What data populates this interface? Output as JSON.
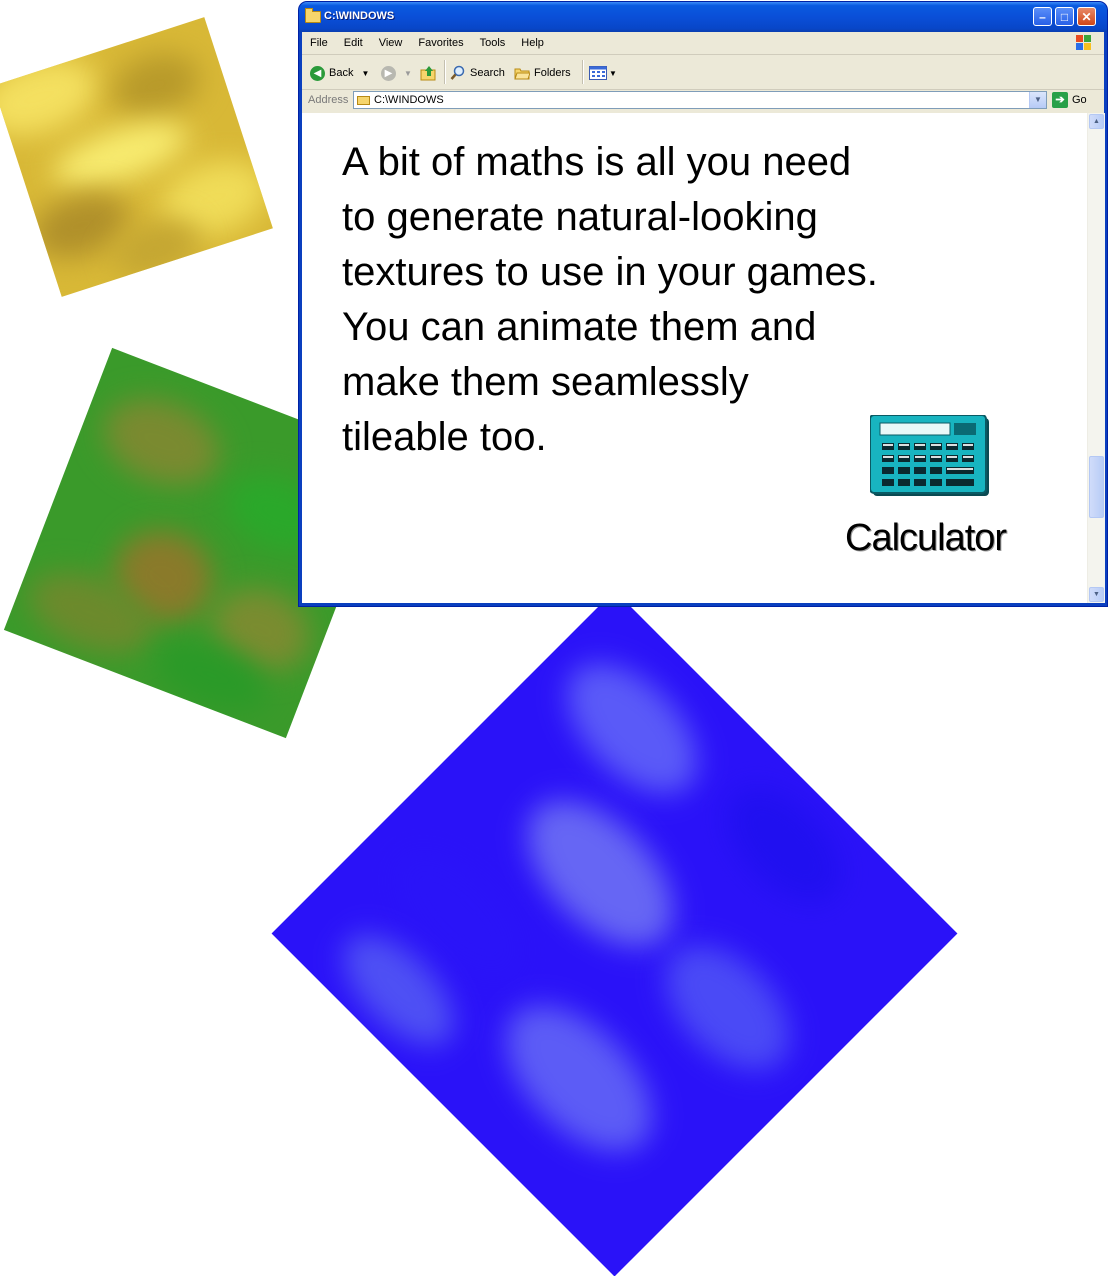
{
  "window": {
    "title": "C:\\WINDOWS",
    "minimize_glyph": "–",
    "maximize_glyph": "□",
    "close_glyph": "✕"
  },
  "menu": {
    "items": [
      "File",
      "Edit",
      "View",
      "Favorites",
      "Tools",
      "Help"
    ]
  },
  "toolbar": {
    "back_label": "Back",
    "search_label": "Search",
    "folders_label": "Folders"
  },
  "address": {
    "label": "Address",
    "value": "C:\\WINDOWS",
    "go_label": "Go"
  },
  "content": {
    "overlay_text": "A bit of maths is all you need to generate natural-looking textures to use in your games. You can animate them and make them seamlessly tileable too.",
    "calculator_label": "Calculator"
  },
  "textures": [
    {
      "name": "yellow-texture",
      "icon": "noise-texture"
    },
    {
      "name": "green-texture",
      "icon": "noise-texture"
    },
    {
      "name": "blue-texture",
      "icon": "noise-texture"
    }
  ],
  "colors": {
    "titlebar": "#0a4fd8",
    "window_chrome": "#ece9d8",
    "yellow_texture": "#d8b836",
    "green_texture": "#3a9a2a",
    "blue_texture": "#2a12f8",
    "calculator_teal": "#18b4c0"
  }
}
